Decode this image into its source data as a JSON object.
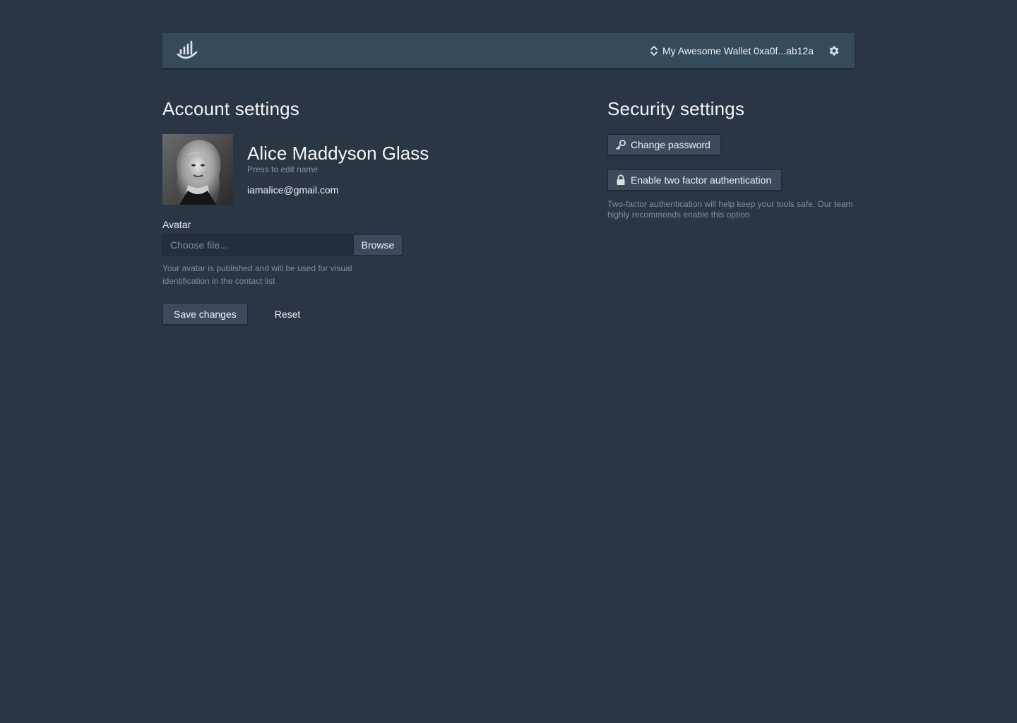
{
  "topbar": {
    "logo_icon": "bar-chart-wave-logo-icon",
    "wallet_label": "My Awesome Wallet 0xa0f...ab12a",
    "wallet_switch_icon": "sort-updown-icon",
    "settings_icon": "gear-icon"
  },
  "account": {
    "title": "Account settings",
    "name": "Alice Maddyson Glass",
    "name_hint": "Press to edit name",
    "email": "iamalice@gmail.com",
    "avatar_label": "Avatar",
    "file_placeholder": "Choose file...",
    "browse_label": "Browse",
    "avatar_help": "Your avatar is published and will be used for visual identification in the contact list",
    "save_label": "Save changes",
    "reset_label": "Reset"
  },
  "security": {
    "title": "Security settings",
    "change_password_label": "Change password",
    "change_password_icon": "key-icon",
    "two_factor_label": "Enable two factor authentication",
    "two_factor_icon": "lock-icon",
    "two_factor_help": "Two-factor authentication will help keep your tools safe. Our team highly recommends enable this option"
  },
  "colors": {
    "background": "#293643",
    "topbar": "#374a59",
    "button": "#3a4c5b",
    "muted_text": "#7f8e9a"
  }
}
